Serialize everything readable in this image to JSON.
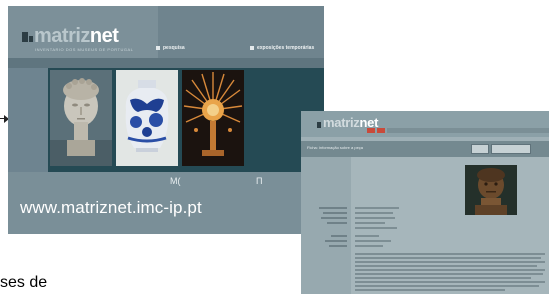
{
  "main_screenshot": {
    "logo": {
      "part1": "matriz",
      "part2": "net"
    },
    "subtitle": "INVENTARIO DOS MUSEUS DE PORTUGAL",
    "nav": {
      "item1": "pesquisa",
      "item2": "exposições temporárias"
    },
    "glyphs": {
      "left": "M(",
      "right": "Π"
    },
    "url": "www.matriznet.imc-ip.pt"
  },
  "detail_screenshot": {
    "logo": {
      "part1": "matriz",
      "part2": "net"
    },
    "toolbar_title": "Ficha: informação sobre a peça"
  },
  "page_text": {
    "partial_line": "ses de"
  },
  "colors": {
    "main_bg": "#6e8490",
    "band": "#254a54",
    "detail_bg": "#9fb0b6",
    "accent_red": "#c94a3a"
  },
  "icons": [
    "logo-block-icon",
    "arrow-icon",
    "nav-square-icon"
  ]
}
